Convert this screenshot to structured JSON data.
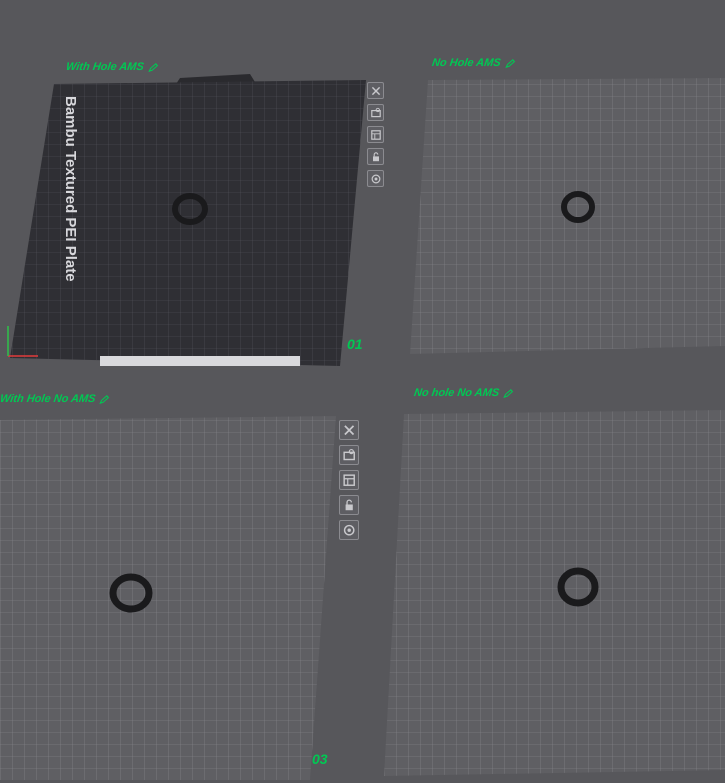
{
  "plates": [
    {
      "label": "With Hole AMS",
      "number": "01",
      "bed_text": "Bambu Textured PEI Plate"
    },
    {
      "label": "No Hole AMS"
    },
    {
      "label": "With Hole No AMS",
      "number": "03"
    },
    {
      "label": "No hole No AMS"
    }
  ],
  "colors": {
    "background": "#57575b",
    "plate_fill": "#5f5f63",
    "active_plate_fill": "#2f2f34",
    "grid_line": "#8a8a8f",
    "label_green": "#00c853",
    "ring": "#1a1a1c"
  },
  "toolbar_icons": [
    "close-icon",
    "auto-orient-icon",
    "arrange-icon",
    "lock-icon",
    "settings-icon"
  ]
}
